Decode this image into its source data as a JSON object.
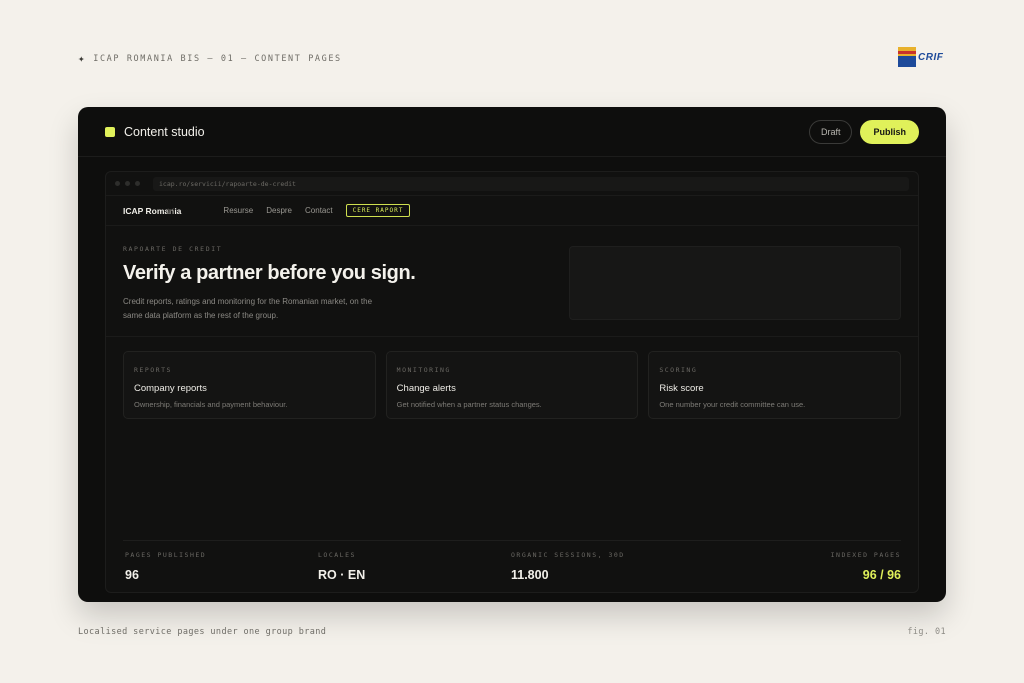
{
  "caption": {
    "top": "ICAP ROMANIA BIS — 01 — CONTENT PAGES",
    "bottom": "Localised service pages under one group brand",
    "figure": "fig. 01"
  },
  "logo": {
    "name": "ICAP CRIF",
    "icap": "ICAP",
    "crif": "CRIF"
  },
  "studio": {
    "title": "Content studio",
    "draft_label": "Draft",
    "publish_label": "Publish"
  },
  "browser": {
    "url": "icap.ro/servicii/rapoarte-de-credit"
  },
  "site": {
    "logo": "ICAP Romania",
    "logo_trailing": "tri",
    "nav": [
      "Resurse",
      "Despre",
      "Contact"
    ],
    "cta": "CERE RAPORT"
  },
  "hero": {
    "eyebrow": "RAPOARTE DE CREDIT",
    "title": "Verify a partner before you sign.",
    "subtitle": "Credit reports, ratings and monitoring for the Romanian market, on the same data platform as the rest of the group."
  },
  "cards": [
    {
      "kicker": "REPORTS",
      "title": "Company reports",
      "desc": "Ownership, financials and payment behaviour."
    },
    {
      "kicker": "MONITORING",
      "title": "Change alerts",
      "desc": "Get notified when a partner status changes."
    },
    {
      "kicker": "SCORING",
      "title": "Risk score",
      "desc": "One number your credit committee can use."
    }
  ],
  "stats": [
    {
      "label": "PAGES PUBLISHED",
      "value": "96"
    },
    {
      "label": "LOCALES",
      "value": "RO · EN"
    },
    {
      "label": "ORGANIC SESSIONS, 30D",
      "value": "11.800"
    },
    {
      "label": "INDEXED PAGES",
      "value": "96 / 96"
    }
  ],
  "colors": {
    "accent": "#e0f15a",
    "page_bg": "#f4f1eb",
    "window_bg": "#0e0e0d"
  }
}
